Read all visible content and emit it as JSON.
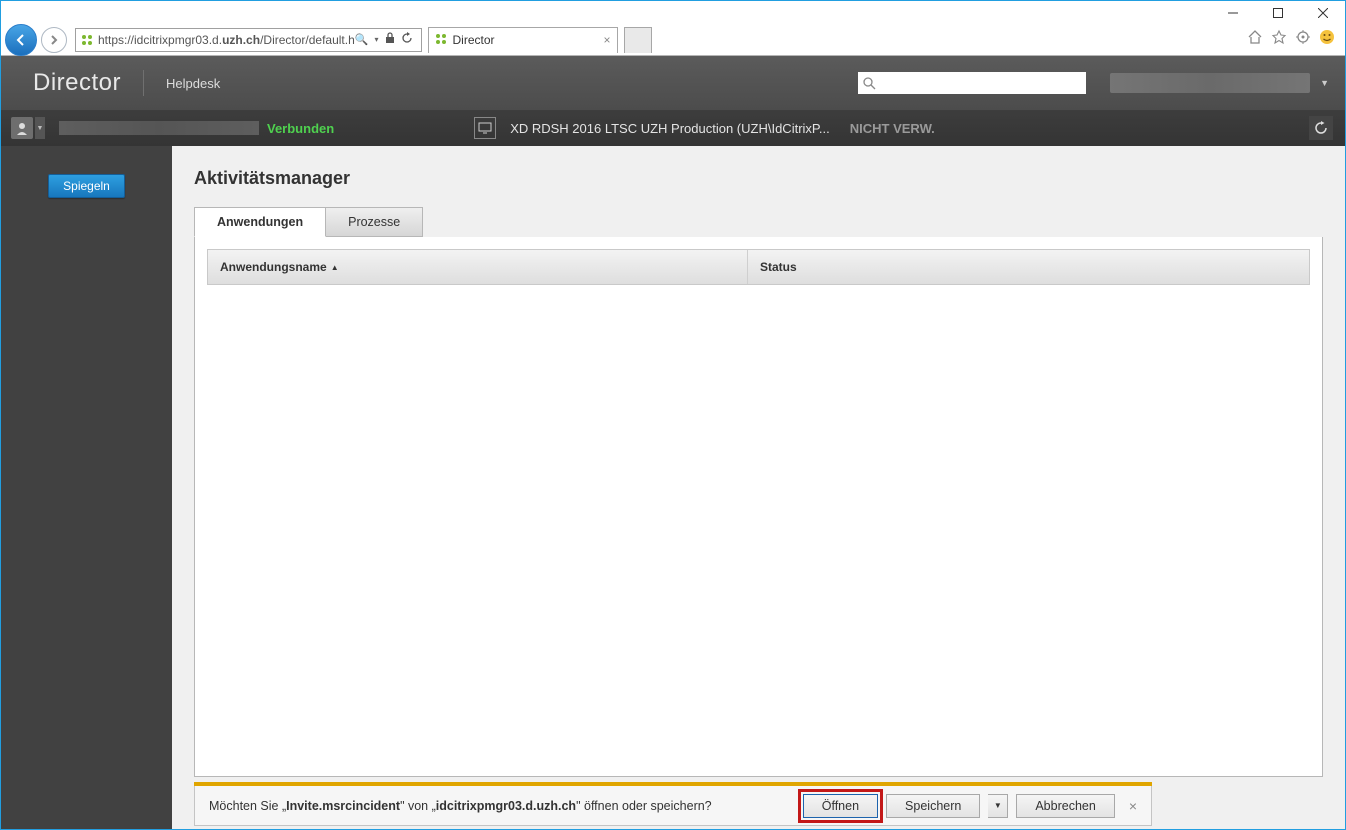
{
  "window": {
    "url": "https://idcitrixpmgr03.d.uzh.ch/Director/default.h",
    "url_domain_bold": "uzh.ch",
    "tab_title": "Director"
  },
  "header": {
    "title": "Director",
    "nav_link": "Helpdesk",
    "search_placeholder": ""
  },
  "subbar": {
    "connection_status": "Verbunden",
    "session_name": "XD RDSH 2016 LTSC UZH Production (UZH\\IdCitrixP...",
    "session_status": "NICHT VERW."
  },
  "sidebar": {
    "mirror_label": "Spiegeln"
  },
  "main": {
    "page_title": "Aktivitätsmanager",
    "tabs": [
      {
        "label": "Anwendungen",
        "active": true
      },
      {
        "label": "Prozesse",
        "active": false
      }
    ],
    "columns": {
      "name": "Anwendungsname",
      "status": "Status"
    }
  },
  "download": {
    "prefix": "Möchten Sie „",
    "filename": "Invite.msrcincident",
    "mid": "\" von „",
    "host": "idcitrixpmgr03.d.uzh.ch",
    "suffix": "\" öffnen oder speichern?",
    "open": "Öffnen",
    "save": "Speichern",
    "cancel": "Abbrechen"
  }
}
